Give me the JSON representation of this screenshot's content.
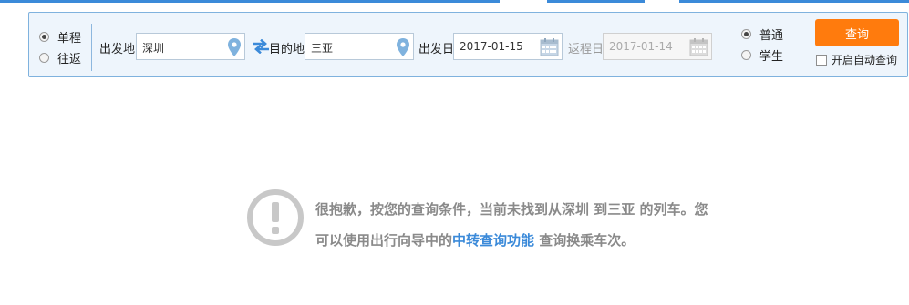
{
  "trip_type": {
    "options": [
      "单程",
      "往返"
    ],
    "selected": "单程"
  },
  "route": {
    "from_label": "出发地",
    "from_value": "深圳",
    "to_label": "目的地",
    "to_value": "三亚"
  },
  "dates": {
    "depart_label": "出发日",
    "depart_value": "2017-01-15",
    "return_label": "返程日",
    "return_value": "2017-01-14"
  },
  "passenger_type": {
    "options": [
      "普通",
      "学生"
    ],
    "selected": "普通"
  },
  "actions": {
    "query_label": "查询",
    "auto_query_label": "开启自动查询",
    "auto_query_checked": false
  },
  "result": {
    "message_before": "很抱歉，按您的查询条件，当前未找到从深圳 到三亚 的列车。您可以使用出行向导中的",
    "link_text": "中转查询功能",
    "message_after": " 查询换乘车次。"
  },
  "colors": {
    "accent": "#3b8ad9",
    "button": "#ff7b0d",
    "panel_bg": "#eef5fc",
    "panel_border": "#7fb2de",
    "icon_gray": "#c8c8c8",
    "pin_blue": "#7fb2de"
  },
  "icons": {
    "from_pin": "map-pin-icon",
    "to_pin": "map-pin-icon",
    "swap": "swap-arrows-icon",
    "calendar": "calendar-icon",
    "warning": "exclamation-circle-icon"
  }
}
